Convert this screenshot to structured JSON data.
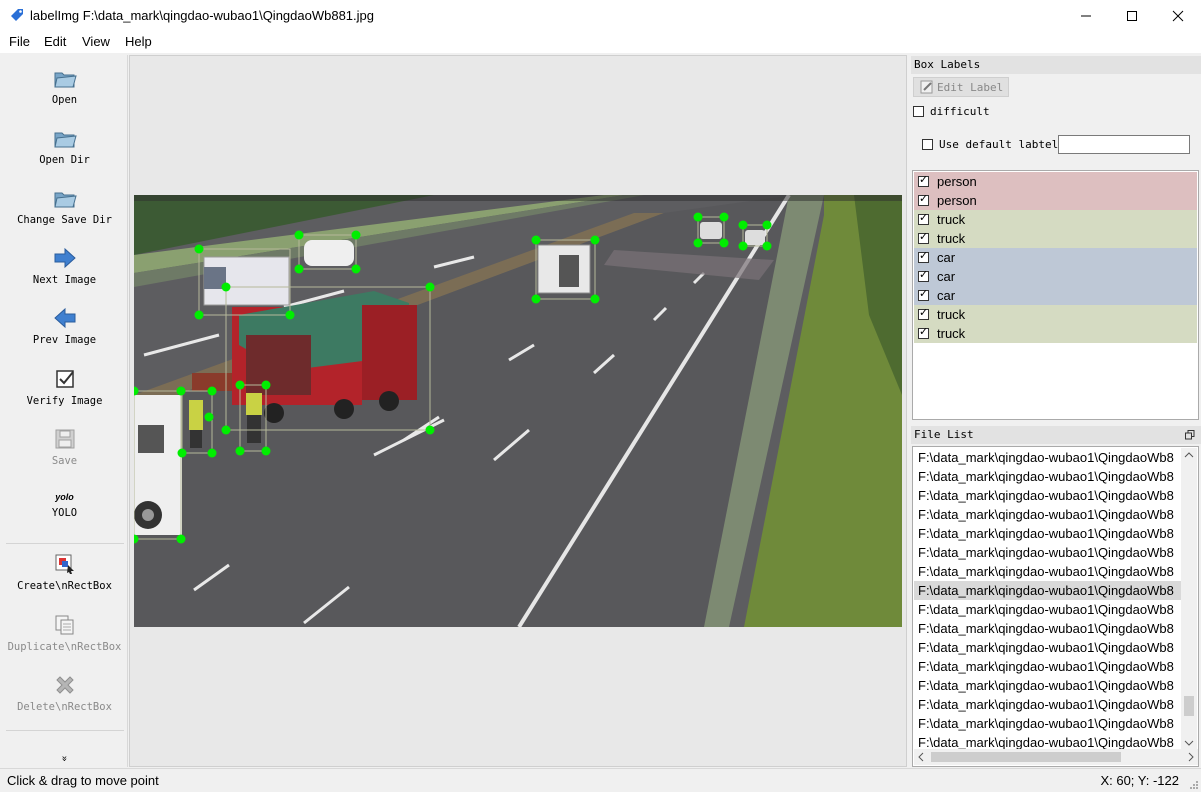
{
  "window": {
    "title": "labelImg F:\\data_mark\\qingdao-wubao1\\QingdaoWb881.jpg"
  },
  "menu": [
    "File",
    "Edit",
    "View",
    "Help"
  ],
  "toolbar": {
    "open": "Open",
    "open_dir": "Open Dir",
    "change_save_dir": "Change Save Dir",
    "next_image": "Next Image",
    "prev_image": "Prev Image",
    "verify_image": "Verify Image",
    "save": "Save",
    "yolo_icon_text": "yolo",
    "yolo": "YOLO",
    "create_rect": "Create\\nRectBox",
    "duplicate_rect": "Duplicate\\nRectBox",
    "delete_rect": "Delete\\nRectBox",
    "more": "»"
  },
  "box_labels": {
    "title": "Box Labels",
    "edit_label": "Edit Label",
    "difficult": "difficult",
    "use_default": "Use default labtel",
    "default_value": "",
    "items": [
      {
        "label": "person",
        "color": "#ddbfc0"
      },
      {
        "label": "person",
        "color": "#ddbfc0"
      },
      {
        "label": "truck",
        "color": "#d5dbc2"
      },
      {
        "label": "truck",
        "color": "#d5dbc2"
      },
      {
        "label": "car",
        "color": "#bec8d6"
      },
      {
        "label": "car",
        "color": "#bec8d6"
      },
      {
        "label": "car",
        "color": "#bec8d6"
      },
      {
        "label": "truck",
        "color": "#d5dbc2"
      },
      {
        "label": "truck",
        "color": "#d5dbc2"
      }
    ]
  },
  "file_list": {
    "title": "File List",
    "items": [
      "F:\\data_mark\\qingdao-wubao1\\QingdaoWb8",
      "F:\\data_mark\\qingdao-wubao1\\QingdaoWb8",
      "F:\\data_mark\\qingdao-wubao1\\QingdaoWb8",
      "F:\\data_mark\\qingdao-wubao1\\QingdaoWb8",
      "F:\\data_mark\\qingdao-wubao1\\QingdaoWb8",
      "F:\\data_mark\\qingdao-wubao1\\QingdaoWb8",
      "F:\\data_mark\\qingdao-wubao1\\QingdaoWb8",
      "F:\\data_mark\\qingdao-wubao1\\QingdaoWb8",
      "F:\\data_mark\\qingdao-wubao1\\QingdaoWb8",
      "F:\\data_mark\\qingdao-wubao1\\QingdaoWb8",
      "F:\\data_mark\\qingdao-wubao1\\QingdaoWb8",
      "F:\\data_mark\\qingdao-wubao1\\QingdaoWb8",
      "F:\\data_mark\\qingdao-wubao1\\QingdaoWb8",
      "F:\\data_mark\\qingdao-wubao1\\QingdaoWb8",
      "F:\\data_mark\\qingdao-wubao1\\QingdaoWb8",
      "F:\\data_mark\\qingdao-wubao1\\QingdaoWb8"
    ],
    "selected_index": 7
  },
  "status": {
    "message": "Click & drag to move point",
    "coords": "X: 60; Y: -122"
  },
  "colors": {
    "handle": "#00ee00",
    "road": "#5d5d60",
    "truck_cab": "#b3232a",
    "tarp": "#3d7a62"
  }
}
